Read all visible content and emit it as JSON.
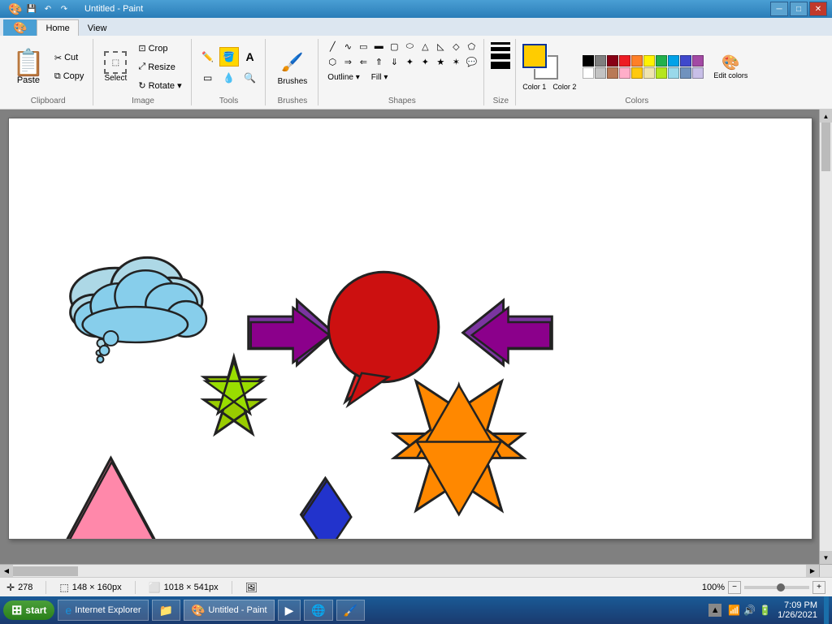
{
  "titlebar": {
    "title": "Untitled - Paint",
    "min": "─",
    "max": "□",
    "close": "✕"
  },
  "quickaccess": {
    "save": "💾",
    "undo": "↶",
    "redo": "↷"
  },
  "tabs": {
    "home": "Home",
    "view": "View"
  },
  "clipboard": {
    "paste": "Paste",
    "cut": "Cut",
    "copy": "Copy",
    "label": "Clipboard"
  },
  "image": {
    "crop": "Crop",
    "resize": "Resize",
    "rotate": "Rotate ▾",
    "select": "Select",
    "label": "Image"
  },
  "tools": {
    "label": "Tools",
    "pencil": "✏",
    "fill": "🪣",
    "text": "A",
    "eraser": "◻",
    "eyedropper": "💧",
    "magnifier": "🔍"
  },
  "brushes": {
    "label": "Brushes",
    "title": "Brushes"
  },
  "shapes": {
    "label": "Shapes",
    "outline": "Outline ▾",
    "fill": "Fill ▾"
  },
  "colors": {
    "size": "Size",
    "color1_label": "Color 1",
    "color2_label": "Color 2",
    "edit_colors": "Edit colors",
    "label": "Colors",
    "palette": [
      "#000000",
      "#7f7f7f",
      "#880015",
      "#ed1c24",
      "#ff7f27",
      "#fff200",
      "#22b14c",
      "#00a2e8",
      "#3f48cc",
      "#a349a4",
      "#ffffff",
      "#c3c3c3",
      "#b97a57",
      "#ffaec9",
      "#ffc90e",
      "#efe4b0",
      "#b5e61d",
      "#99d9ea",
      "#7092be",
      "#c8bfe7"
    ],
    "active_color": "#ffcc00"
  },
  "status": {
    "cursor_pos": "278",
    "selection_size": "148 × 160px",
    "canvas_size": "1018 × 541px",
    "zoom": "100%",
    "taskbar_item": "Internet Explorer"
  },
  "taskbar": {
    "start": "start",
    "time": "7:09 PM",
    "date": "1/26/2021",
    "ie_label": "Internet Explorer",
    "paint_label": "Untitled - Paint"
  }
}
